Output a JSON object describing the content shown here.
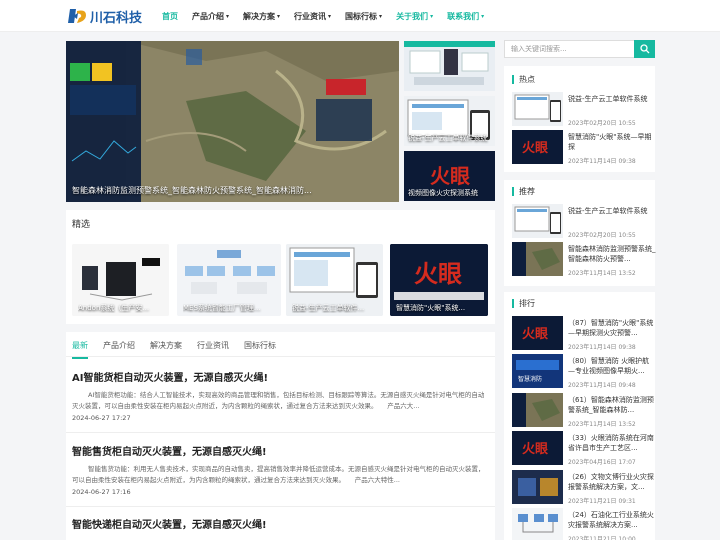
{
  "header": {
    "logo_text": "川石科技",
    "nav": [
      {
        "label": "首页",
        "active": true,
        "caret": false,
        "green": false
      },
      {
        "label": "产品介绍",
        "active": false,
        "caret": true,
        "green": false
      },
      {
        "label": "解决方案",
        "active": false,
        "caret": true,
        "green": false
      },
      {
        "label": "行业资讯",
        "active": false,
        "caret": true,
        "green": false
      },
      {
        "label": "国标行标",
        "active": false,
        "caret": true,
        "green": false
      },
      {
        "label": "关于我们",
        "active": false,
        "caret": true,
        "green": true
      },
      {
        "label": "联系我们",
        "active": false,
        "caret": true,
        "green": true
      }
    ]
  },
  "hero": {
    "caption": "智能森林消防监测预警系统_智能森林防火预警系统_智能森林消防...",
    "thumbs": [
      "",
      "锐益-生产云工单软件系统",
      "视频图像火灾探测系统"
    ]
  },
  "featured": {
    "title": "精选",
    "cards": [
      "Andon系统（生产安...",
      "MES系统智能工厂管理...",
      "锐益-生产云工单软件...",
      "智慧消防\"火眼\"系统..."
    ]
  },
  "tabs": [
    "最新",
    "产品介绍",
    "解决方案",
    "行业资讯",
    "国标行标"
  ],
  "articles": [
    {
      "title": "AI智能货柜自动灭火装置，无源自感灭火绳!",
      "excerpt": "AI智能货柜功能：结合人工智能技术，实现高效的商品管理和销售，包括目标检测、目标跟踪等算法。无源自感灭火绳是针对电气柜的自动灭火装置，可以自由柔性安装在柜内易起火点附近，为内含颗粒的绳索状，通过复合方法来达到灭火效果。　　产品六大...",
      "date": "2024-06-27 17:27"
    },
    {
      "title": "智能售货柜自动灭火装置，无源自感灭火绳!",
      "excerpt": "智能售货功能：利用无人售卖技术，实现商品的自动售卖，提高销售效率并降低运营成本。无源自感灭火绳是针对电气柜的自动灭火装置，可以自由柔性安装在柜内易起火点附近，为内含颗粒的绳索状，通过复合方法来达到灭火效果。　　产品六大特性...",
      "date": "2024-06-27 17:16"
    },
    {
      "title": "智能快递柜自动灭火装置，无源自感灭火绳!",
      "excerpt": "",
      "date": ""
    }
  ],
  "sidebar": {
    "search_placeholder": "输入关键词搜索...",
    "hot_title": "热点",
    "hot": [
      {
        "title": "锐益-生产云工单软件系统",
        "date": "2023年02月20日 10:55"
      },
      {
        "title": "智慧消防\"火眼\"系统—早期探",
        "date": "2023年11月14日 09:38"
      }
    ],
    "rec_title": "推荐",
    "rec": [
      {
        "title": "锐益-生产云工单软件系统",
        "date": "2023年02月20日 10:55"
      },
      {
        "title": "智能森林消防监测预警系统_智能森林防火预警...",
        "date": "2023年11月14日 13:52"
      }
    ],
    "rank_title": "排行",
    "rank": [
      {
        "title": "（87）智慧消防\"火眼\"系统—早期探测火灾预警...",
        "date": "2023年11月14日 09:38"
      },
      {
        "title": "（80）智慧消防 火眼护航—专业视频图像早期火...",
        "date": "2023年11月14日 09:48"
      },
      {
        "title": "（61）智能森林消防监测预警系统_智能森林防...",
        "date": "2023年11月14日 13:52"
      },
      {
        "title": "（33）火眼消防系统在河南省许昌市生产工艺区...",
        "date": "2023年04月16日 17:07"
      },
      {
        "title": "（26）文物文博行业火灾探报警系统解决方案，文...",
        "date": "2023年11月21日 09:31"
      },
      {
        "title": "（24）石油化工行业系统火灾报警系统解决方案...",
        "date": "2023年11月21日 10:00"
      }
    ]
  },
  "colors": {
    "accent": "#16b9a0",
    "logo": "#1f5fa8",
    "fire_red": "#d52b1e",
    "dark_blue": "#0d1e3d"
  }
}
